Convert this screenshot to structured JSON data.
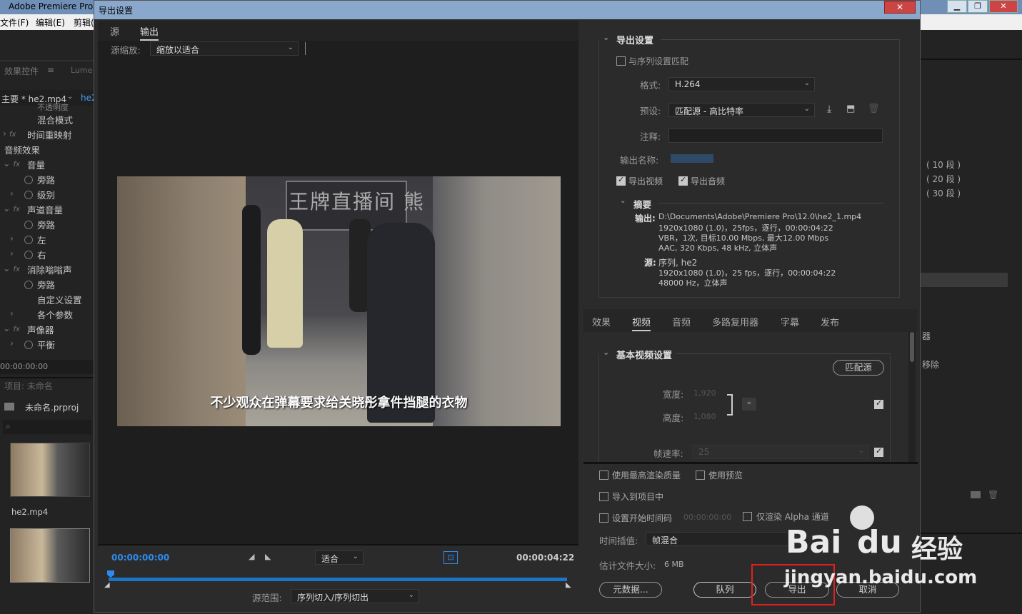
{
  "app": {
    "title": "Adobe Premiere Pro",
    "menu": [
      "文件(F)",
      "编辑(E)",
      "剪辑("
    ]
  },
  "left_panel": {
    "tab_effects": "效果控件",
    "tab_lumetri": "Lume",
    "clip_label": "主要 * he2.mp4",
    "clip_tag": "he2",
    "rows": [
      "不透明度",
      "混合模式",
      "时间重映射",
      "音频效果",
      "音量",
      "旁路",
      "级别",
      "声道音量",
      "旁路",
      "左",
      "右",
      "消除嗡嗡声",
      "旁路",
      "自定义设置",
      "各个参数",
      "声像器",
      "平衡"
    ],
    "timecode": "00:00:00:00",
    "project_title": "项目: 未命名",
    "project_file": "未命名.prproj",
    "media_name": "he2.mp4"
  },
  "right_panel": {
    "items": [
      "( 10 段 )",
      "( 20 段 )",
      "( 30 段 )",
      "器",
      "移除"
    ]
  },
  "dialog": {
    "title": "导出设置",
    "close_label": "✕",
    "source_tab": "源",
    "output_tab": "输出",
    "source_scale_label": "源缩放:",
    "source_scale_value": "缩放以适合",
    "subtitle_text": "不少观众在弹幕要求给关晓彤拿件挡腿的衣物",
    "sign_text": "王牌直播间 熊",
    "timecode_start": "00:00:00:00",
    "timecode_end": "00:00:04:22",
    "fit_value": "适合",
    "source_range_label": "源范围:",
    "source_range_value": "序列切入/序列切出",
    "export_settings": {
      "header": "导出设置",
      "match_sequence": "与序列设置匹配",
      "format_label": "格式:",
      "format_value": "H.264",
      "preset_label": "预设:",
      "preset_value": "匹配源 - 高比特率",
      "comment_label": "注释:",
      "output_name_label": "输出名称:",
      "export_video": "导出视频",
      "export_audio": "导出音频",
      "summary_header": "摘要",
      "output_label": "输出:",
      "output_lines": [
        "D:\\Documents\\Adobe\\Premiere Pro\\12.0\\he2_1.mp4",
        "1920x1080 (1.0)，25fps，逐行，00:00:04:22",
        "VBR，1次, 目标10.00 Mbps, 最大12.00 Mbps",
        "AAC, 320 Kbps, 48  kHz, 立体声"
      ],
      "source_label": "源:",
      "source_lines": [
        "序列, he2",
        "1920x1080 (1.0)，25 fps，逐行，00:00:04:22",
        "48000 Hz，立体声"
      ]
    },
    "tabs": [
      "效果",
      "视频",
      "音频",
      "多路复用器",
      "字幕",
      "发布"
    ],
    "video_settings": {
      "header": "基本视频设置",
      "match_source_button": "匹配源",
      "width_label": "宽度:",
      "width_value": "1,920",
      "height_label": "高度:",
      "height_value": "1,080",
      "framerate_label": "帧速率:",
      "framerate_value": "25"
    },
    "options": {
      "max_render": "使用最高渲染质量",
      "use_preview": "使用预览",
      "import_project": "导入到项目中",
      "set_start_tc": "设置开始时间码",
      "start_tc_value": "00:00:00:00",
      "render_alpha": "仅渲染 Alpha 通道",
      "interp_label": "时间插值:",
      "interp_value": "帧混合",
      "filesize_label": "估计文件大小:",
      "filesize_value": "6 MB"
    },
    "buttons": {
      "metadata": "元数据...",
      "queue": "队列",
      "export": "导出",
      "cancel": "取消"
    }
  },
  "watermark": {
    "brand": "Bai",
    "brand2": "du",
    "jingyan": "经验",
    "url": "jingyan.baidu.com"
  },
  "colors": {
    "accent_blue": "#2d8ceb",
    "highlight_red": "#e02020"
  }
}
